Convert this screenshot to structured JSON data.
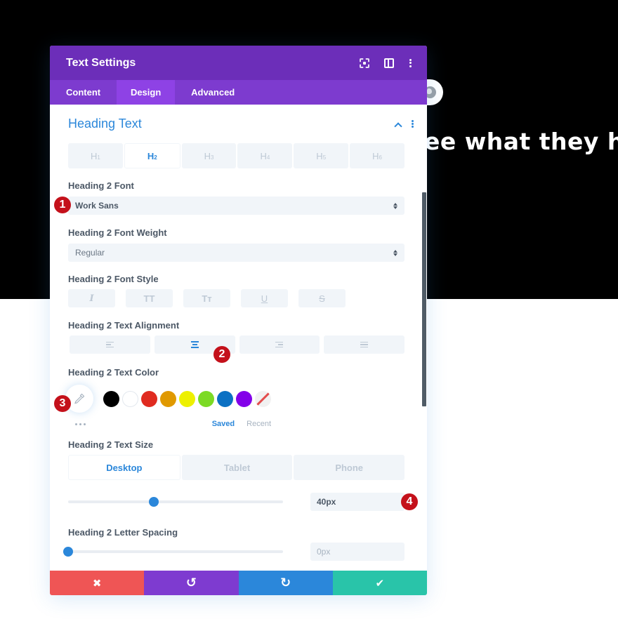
{
  "background": {
    "heading_fragment": "ee what they hav"
  },
  "panel": {
    "title": "Text Settings",
    "header_icons": [
      "expand-icon",
      "split-view-icon",
      "more-options-icon"
    ],
    "tabs": [
      {
        "label": "Content",
        "active": false
      },
      {
        "label": "Design",
        "active": true
      },
      {
        "label": "Advanced",
        "active": false
      }
    ]
  },
  "section": {
    "title": "Heading Text",
    "heading_levels": [
      {
        "label": "H",
        "sub": "1",
        "active": false
      },
      {
        "label": "H",
        "sub": "2",
        "active": true
      },
      {
        "label": "H",
        "sub": "3",
        "active": false
      },
      {
        "label": "H",
        "sub": "4",
        "active": false
      },
      {
        "label": "H",
        "sub": "5",
        "active": false
      },
      {
        "label": "H",
        "sub": "6",
        "active": false
      }
    ]
  },
  "fields": {
    "font": {
      "label": "Heading 2 Font",
      "value": "Work Sans"
    },
    "font_weight": {
      "label": "Heading 2 Font Weight",
      "value": "Regular"
    },
    "font_style": {
      "label": "Heading 2 Font Style",
      "buttons": [
        {
          "name": "italic",
          "glyph": "I"
        },
        {
          "name": "uppercase",
          "glyph": "TT"
        },
        {
          "name": "capitalize",
          "glyph": "Tт"
        },
        {
          "name": "underline",
          "glyph": "U"
        },
        {
          "name": "strikethrough",
          "glyph": "S"
        }
      ]
    },
    "text_alignment": {
      "label": "Heading 2 Text Alignment",
      "options": [
        "left",
        "center",
        "right",
        "justify"
      ],
      "selected": "center"
    },
    "text_color": {
      "label": "Heading 2 Text Color",
      "swatches": [
        {
          "name": "black",
          "color": "#000000"
        },
        {
          "name": "white",
          "color": "#ffffff"
        },
        {
          "name": "red",
          "color": "#e02b20"
        },
        {
          "name": "orange",
          "color": "#e09900"
        },
        {
          "name": "yellow",
          "color": "#edf000"
        },
        {
          "name": "green",
          "color": "#7cda24"
        },
        {
          "name": "blue",
          "color": "#0c71c3"
        },
        {
          "name": "purple",
          "color": "#8300e9"
        },
        {
          "name": "none",
          "color": "transparent"
        }
      ],
      "saved_label": "Saved",
      "recent_label": "Recent"
    },
    "text_size": {
      "label": "Heading 2 Text Size",
      "devices": [
        {
          "label": "Desktop",
          "active": true
        },
        {
          "label": "Tablet",
          "active": false
        },
        {
          "label": "Phone",
          "active": false
        }
      ],
      "value": "40px",
      "slider_fraction": 0.4
    },
    "letter_spacing": {
      "label": "Heading 2 Letter Spacing",
      "value": "0px",
      "slider_fraction": 0.0
    }
  },
  "footer": {
    "buttons": [
      {
        "name": "discard",
        "glyph": "✖",
        "color": "#ef5555"
      },
      {
        "name": "undo",
        "glyph": "↺",
        "color": "#7e3bd0"
      },
      {
        "name": "redo",
        "glyph": "↻",
        "color": "#2b87da"
      },
      {
        "name": "save",
        "glyph": "✔",
        "color": "#29c4a9"
      }
    ]
  },
  "annotations": [
    "1",
    "2",
    "3",
    "4"
  ],
  "colors": {
    "header_purple": "#6c2eb9",
    "tab_purple": "#7d3bcf",
    "tab_active": "#8e42e5",
    "accent_blue": "#2b87da",
    "badge_red": "#c4111b"
  }
}
